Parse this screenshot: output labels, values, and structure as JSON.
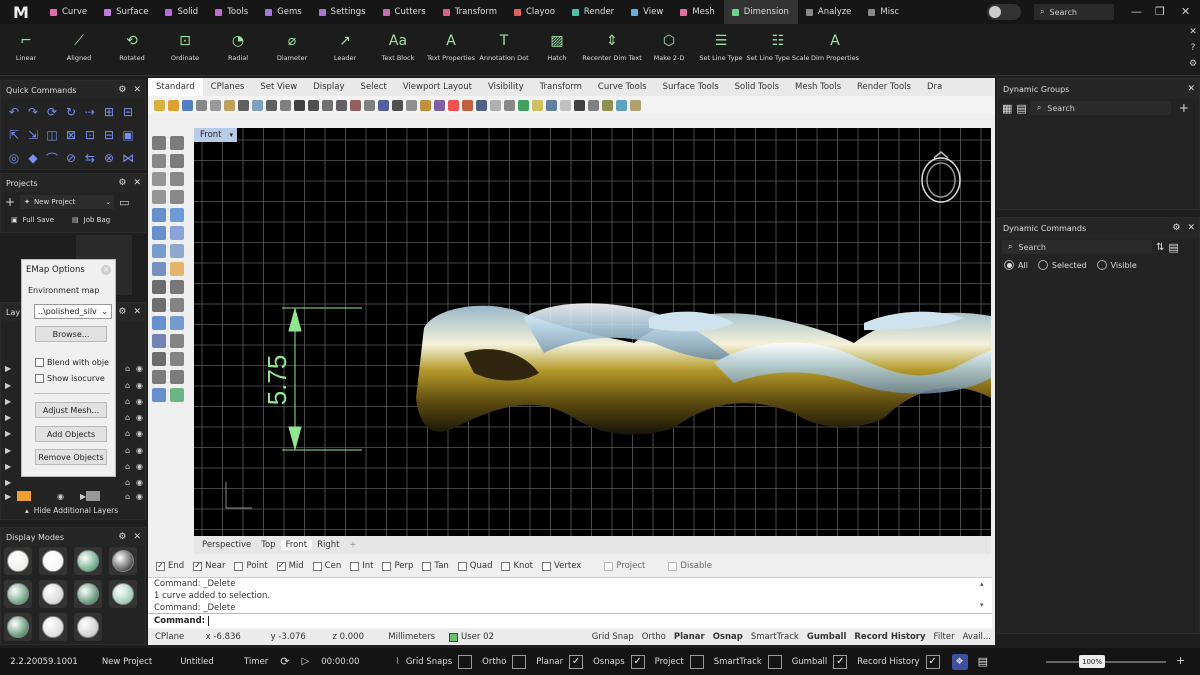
{
  "menu": {
    "logo": "M",
    "tabs": [
      {
        "label": "Curve",
        "color": "#e46bb2"
      },
      {
        "label": "Surface",
        "color": "#c47be0"
      },
      {
        "label": "Solid",
        "color": "#b86bd8"
      },
      {
        "label": "Tools",
        "color": "#c06ad6"
      },
      {
        "label": "Gems",
        "color": "#a37ad8"
      },
      {
        "label": "Settings",
        "color": "#b070d0"
      },
      {
        "label": "Cutters",
        "color": "#c56ab8"
      },
      {
        "label": "Transform",
        "color": "#e0608c"
      },
      {
        "label": "Clayoo",
        "color": "#e06060"
      },
      {
        "label": "Render",
        "color": "#4fbfa8"
      },
      {
        "label": "View",
        "color": "#5fb0e0"
      },
      {
        "label": "Mesh",
        "color": "#e070a0"
      },
      {
        "label": "Dimension",
        "color": "#6fd08a"
      },
      {
        "label": "Analyze",
        "color": "#888888"
      },
      {
        "label": "Misc",
        "color": "#888888"
      }
    ],
    "active_tab": "Dimension",
    "search_placeholder": "Search"
  },
  "ribbon": [
    {
      "label": "Linear",
      "icon": "linear-dim-icon"
    },
    {
      "label": "Aligned",
      "icon": "aligned-dim-icon"
    },
    {
      "label": "Rotated",
      "icon": "rotated-dim-icon"
    },
    {
      "label": "Ordinate",
      "icon": "ordinate-dim-icon"
    },
    {
      "label": "Radial",
      "icon": "radial-dim-icon"
    },
    {
      "label": "Diameter",
      "icon": "diameter-dim-icon"
    },
    {
      "label": "Leader",
      "icon": "leader-icon"
    },
    {
      "label": "Text Block",
      "icon": "text-block-icon"
    },
    {
      "label": "Text Properties",
      "icon": "text-properties-icon"
    },
    {
      "label": "Annotation Dot",
      "icon": "annotation-dot-icon"
    },
    {
      "label": "Hatch",
      "icon": "hatch-icon"
    },
    {
      "label": "Recenter Dim Text",
      "icon": "recenter-dim-text-icon"
    },
    {
      "label": "Make 2-D",
      "icon": "make-2d-icon"
    },
    {
      "label": "Set Line Type",
      "icon": "set-line-type-icon"
    },
    {
      "label": "Set Line Type Scale",
      "icon": "set-line-type-scale-icon"
    },
    {
      "label": "Dim Properties",
      "icon": "dim-properties-icon"
    }
  ],
  "quick_commands": {
    "title": "Quick Commands"
  },
  "projects": {
    "title": "Projects",
    "project_name": "New Project",
    "full_save": "Full Save",
    "job_bag": "Job Bag"
  },
  "layers": {
    "title": "Layers",
    "hide_label": "Hide Additional Layers"
  },
  "display_modes": {
    "title": "Display Modes"
  },
  "emap": {
    "title": "EMap Options",
    "env_label": "Environment map",
    "selected": "..\\polished_silv",
    "browse": "Browse...",
    "blend": "Blend with obje",
    "isocurve": "Show isocurve",
    "adjust": "Adjust Mesh...",
    "add": "Add Objects",
    "remove": "Remove Objects"
  },
  "viewport_tabs": [
    "Standard",
    "CPlanes",
    "Set View",
    "Display",
    "Select",
    "Viewport Layout",
    "Visibility",
    "Transform",
    "Curve Tools",
    "Surface Tools",
    "Solid Tools",
    "Mesh Tools",
    "Render Tools",
    "Dra"
  ],
  "viewport": {
    "name": "Front",
    "dimension": "5.75"
  },
  "view_tabs": [
    "Perspective",
    "Top",
    "Front",
    "Right"
  ],
  "active_view": "Front",
  "osnaps": [
    {
      "label": "End",
      "checked": true
    },
    {
      "label": "Near",
      "checked": true
    },
    {
      "label": "Point",
      "checked": false
    },
    {
      "label": "Mid",
      "checked": true
    },
    {
      "label": "Cen",
      "checked": false
    },
    {
      "label": "Int",
      "checked": false
    },
    {
      "label": "Perp",
      "checked": false
    },
    {
      "label": "Tan",
      "checked": false
    },
    {
      "label": "Quad",
      "checked": false
    },
    {
      "label": "Knot",
      "checked": false
    },
    {
      "label": "Vertex",
      "checked": false
    },
    {
      "label": "Project",
      "checked": false,
      "disabled": true
    },
    {
      "label": "Disable",
      "checked": false,
      "disabled": true
    }
  ],
  "command_history": [
    "Command: _Delete",
    "1 curve added to selection.",
    "Command: _Delete"
  ],
  "command_prompt": "Command:",
  "status": {
    "cplane": "CPlane",
    "x": "x -6.836",
    "y": "y -3.076",
    "z": "z 0.000",
    "units": "Millimeters",
    "layer": "User 02",
    "toggles": [
      {
        "label": "Grid Snap",
        "bold": false
      },
      {
        "label": "Ortho",
        "bold": false
      },
      {
        "label": "Planar",
        "bold": true
      },
      {
        "label": "Osnap",
        "bold": true
      },
      {
        "label": "SmartTrack",
        "bold": false
      },
      {
        "label": "Gumball",
        "bold": true
      },
      {
        "label": "Record History",
        "bold": true
      },
      {
        "label": "Filter",
        "bold": false
      },
      {
        "label": "Avail...",
        "bold": false
      }
    ]
  },
  "dynamic_groups": {
    "title": "Dynamic Groups",
    "search": "Search"
  },
  "dynamic_commands": {
    "title": "Dynamic Commands",
    "search": "Search",
    "filters": [
      "All",
      "Selected",
      "Visible"
    ],
    "selected_filter": "All"
  },
  "bottom": {
    "version": "2.2.20059.1001",
    "project": "New Project",
    "file": "Untitled",
    "timer_label": "Timer",
    "timer": "00:00:00",
    "toggles": [
      {
        "label": "Grid Snaps",
        "checked": false
      },
      {
        "label": "Ortho",
        "checked": false
      },
      {
        "label": "Planar",
        "checked": true
      },
      {
        "label": "Osnaps",
        "checked": true
      },
      {
        "label": "Project",
        "checked": false
      },
      {
        "label": "SmartTrack",
        "checked": false
      },
      {
        "label": "Gumball",
        "checked": true
      },
      {
        "label": "Record History",
        "checked": true
      }
    ],
    "zoom": "100%"
  }
}
